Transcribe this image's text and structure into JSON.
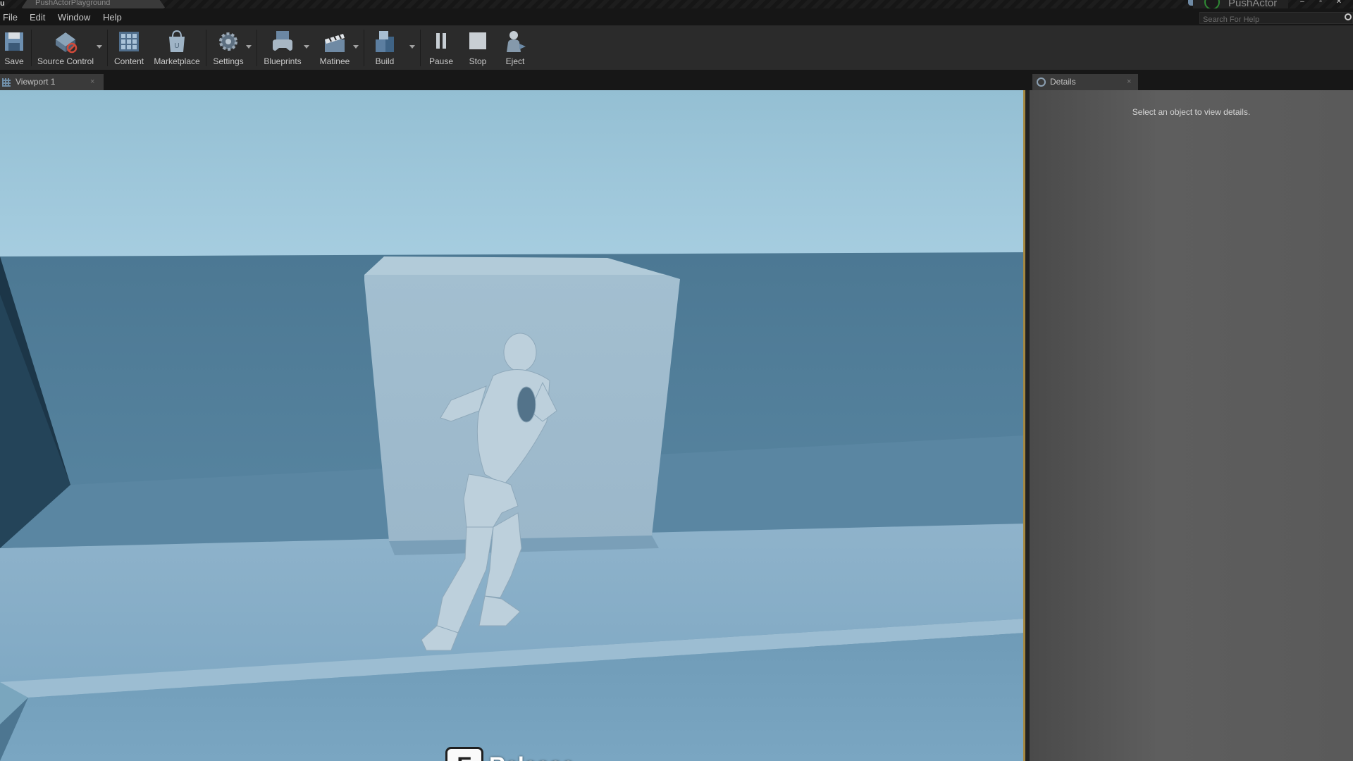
{
  "window": {
    "logo": "u",
    "doc_tab": "PushActorPlayground",
    "project_name": "PushActor",
    "controls": [
      "–",
      "▫",
      "✕"
    ]
  },
  "menu": [
    "File",
    "Edit",
    "Window",
    "Help"
  ],
  "search": {
    "placeholder": "Search For Help"
  },
  "toolbar": {
    "save": "Save",
    "source_control": "Source Control",
    "content": "Content",
    "marketplace": "Marketplace",
    "settings": "Settings",
    "blueprints": "Blueprints",
    "matinee": "Matinee",
    "build": "Build",
    "pause": "Pause",
    "stop": "Stop",
    "eject": "Eject"
  },
  "tabs": {
    "viewport": "Viewport 1",
    "details": "Details",
    "close": "×"
  },
  "details": {
    "empty_message": "Select an object to view details."
  },
  "hud": {
    "key": "E",
    "action": "Release"
  },
  "colors": {
    "viewport_border": "#a48842",
    "accent": "#2f8a34"
  }
}
